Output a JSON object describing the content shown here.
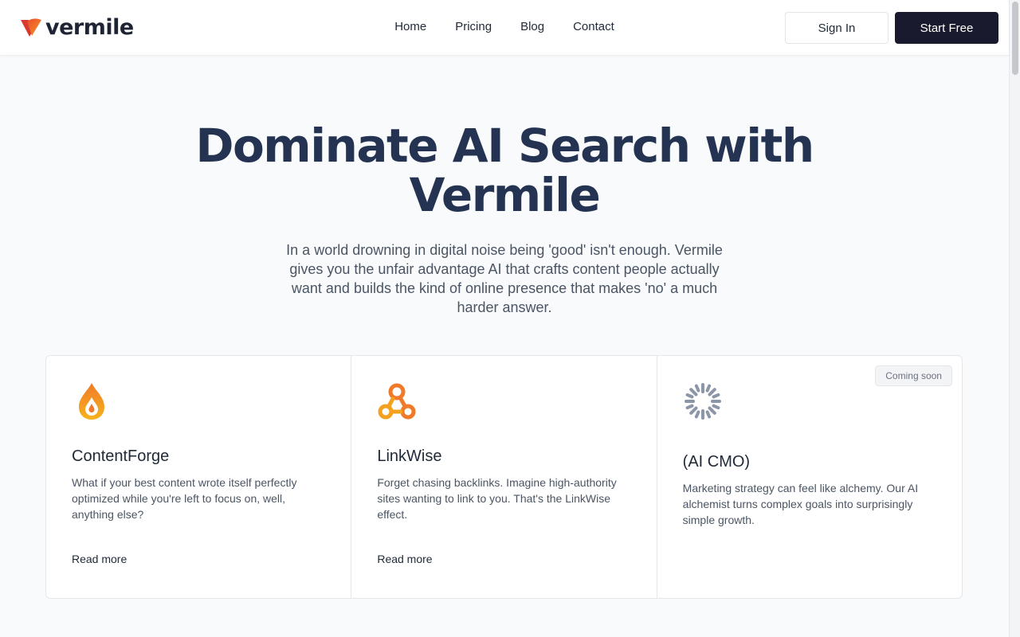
{
  "brand": {
    "name": "vermile"
  },
  "nav": [
    {
      "label": "Home"
    },
    {
      "label": "Pricing"
    },
    {
      "label": "Blog"
    },
    {
      "label": "Contact"
    }
  ],
  "actions": {
    "signin": "Sign In",
    "start": "Start Free"
  },
  "hero": {
    "title_line1": "Dominate AI Search with",
    "title_line2": "Vermile",
    "subtitle": "In a world drowning in digital noise being 'good' isn't enough. Vermile gives you the unfair advantage AI that crafts content people actually want and builds the kind of online presence that makes 'no' a much harder answer."
  },
  "cards": [
    {
      "icon": "flame-icon",
      "title": "ContentForge",
      "description": "What if your best content wrote itself perfectly optimized while you're left to focus on, well, anything else?",
      "link": "Read more"
    },
    {
      "icon": "link-network-icon",
      "title": "LinkWise",
      "description": "Forget chasing backlinks. Imagine high-authority sites wanting to link to you. That's the LinkWise effect.",
      "link": "Read more"
    },
    {
      "icon": "loading-spinner-icon",
      "title": "(AI CMO)",
      "description": "Marketing strategy can feel like alchemy. Our AI alchemist turns complex goals into surprisingly simple growth.",
      "badge": "Coming soon"
    }
  ],
  "colors": {
    "accent_dark": "#1a1a2e",
    "heading": "#253352",
    "brand_orange": "#f0782a",
    "brand_red": "#d9382e"
  }
}
